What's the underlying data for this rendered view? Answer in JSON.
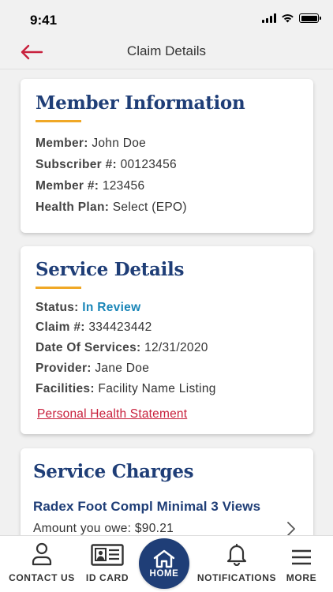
{
  "status_bar": {
    "time": "9:41"
  },
  "header": {
    "title": "Claim Details"
  },
  "member_info": {
    "title": "Member Information",
    "rows": [
      {
        "label": "Member:",
        "value": "John Doe"
      },
      {
        "label": "Subscriber #:",
        "value": "00123456"
      },
      {
        "label": "Member #:",
        "value": "123456"
      },
      {
        "label": "Health Plan:",
        "value": "Select (EPO)"
      }
    ]
  },
  "service_details": {
    "title": "Service Details",
    "status_label": "Status:",
    "status_value": "In Review",
    "rows": [
      {
        "label": "Claim #:",
        "value": "334423442"
      },
      {
        "label": "Date Of Services:",
        "value": "12/31/2020"
      },
      {
        "label": "Provider:",
        "value": "Jane Doe"
      },
      {
        "label": "Facilities:",
        "value": "Facility Name Listing"
      }
    ],
    "link": "Personal Health Statement"
  },
  "service_charges": {
    "title": "Service Charges",
    "item_name": "Radex Foot Compl Minimal 3 Views",
    "item_sub": "Amount you owe: $90.21"
  },
  "tabbar": {
    "contact": "CONTACT US",
    "idcard": "ID CARD",
    "home": "HOME",
    "notifications": "NOTIFICATIONS",
    "more": "MORE"
  },
  "colors": {
    "brand_navy": "#1f3e77",
    "accent_gold": "#f0a826",
    "link_red": "#c8203c",
    "status_blue": "#1a86b8"
  }
}
